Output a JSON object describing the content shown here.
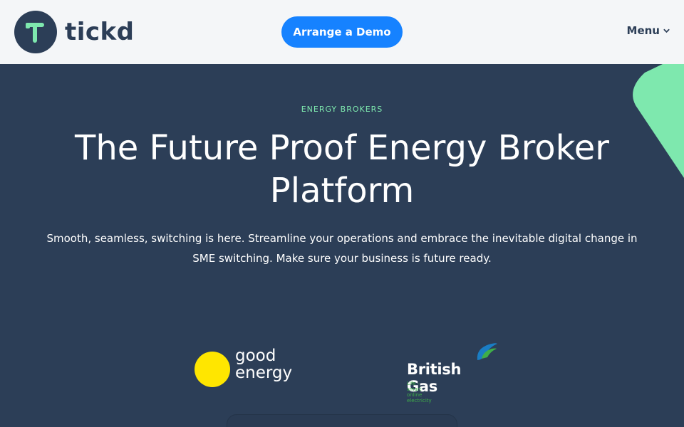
{
  "header": {
    "logo_text": "tickd",
    "demo_label": "Arrange a Demo",
    "menu_label": "Menu"
  },
  "hero": {
    "eyebrow": "ENERGY BROKERS",
    "title": "The Future Proof Energy Broker Platform",
    "subtitle": "Smooth, seamless, switching is here. Streamline your operations and embrace the inevitable digital change in SME switching. Make sure your business is future ready."
  },
  "partners": [
    {
      "name": "good energy",
      "line1": "good",
      "line2": "energy",
      "color": "#ffe600"
    },
    {
      "name": "British Gas",
      "tagline": "Life – smart online electricity",
      "color": "#3fae49"
    }
  ],
  "icons": {
    "logo": "tickd-logo-icon",
    "menu": "chevron-down-icon",
    "good_energy": "sun-circle-icon",
    "british_gas": "flame-icon"
  },
  "colors": {
    "brand_navy": "#2c3e57",
    "accent_green": "#7ee8ae",
    "button_blue": "#1682ff",
    "header_bg": "#f4f6f8"
  }
}
